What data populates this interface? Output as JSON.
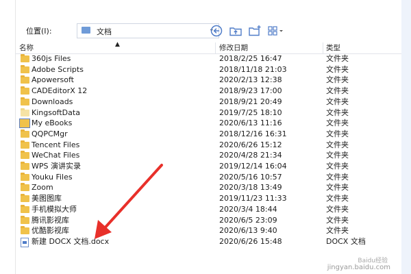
{
  "location": {
    "label": "位置(I):",
    "value": "文档"
  },
  "columns": {
    "name": "名称",
    "date": "修改日期",
    "type": "类型"
  },
  "files": [
    {
      "name": "360js Files",
      "date": "2018/2/25 16:47",
      "type": "文件夹",
      "icon": "folder-icon"
    },
    {
      "name": "Adobe Scripts",
      "date": "2018/11/18 21:03",
      "type": "文件夹",
      "icon": "folder-icon"
    },
    {
      "name": "Apowersoft",
      "date": "2020/2/13 12:38",
      "type": "文件夹",
      "icon": "folder-icon"
    },
    {
      "name": "CADEditorX 12",
      "date": "2018/9/23 17:00",
      "type": "文件夹",
      "icon": "folder-icon"
    },
    {
      "name": "Downloads",
      "date": "2018/9/21 20:49",
      "type": "文件夹",
      "icon": "folder-icon"
    },
    {
      "name": "KingsoftData",
      "date": "2019/7/25 18:10",
      "type": "文件夹",
      "icon": "folder-icon"
    },
    {
      "name": "My eBooks",
      "date": "2020/6/13 11:16",
      "type": "文件夹",
      "icon": "ebook-folder-icon"
    },
    {
      "name": "QQPCMgr",
      "date": "2018/12/16 16:31",
      "type": "文件夹",
      "icon": "folder-icon"
    },
    {
      "name": "Tencent Files",
      "date": "2020/6/26 15:12",
      "type": "文件夹",
      "icon": "folder-icon"
    },
    {
      "name": "WeChat Files",
      "date": "2020/4/28 21:34",
      "type": "文件夹",
      "icon": "folder-icon"
    },
    {
      "name": "WPS 演讲实录",
      "date": "2019/12/14 16:04",
      "type": "文件夹",
      "icon": "folder-icon"
    },
    {
      "name": "Youku Files",
      "date": "2020/5/16 10:57",
      "type": "文件夹",
      "icon": "folder-icon"
    },
    {
      "name": "Zoom",
      "date": "2020/3/18 13:49",
      "type": "文件夹",
      "icon": "folder-icon"
    },
    {
      "name": "美图图库",
      "date": "2019/11/23 11:33",
      "type": "文件夹",
      "icon": "folder-icon"
    },
    {
      "name": "手机模拟大师",
      "date": "2020/3/4 18:44",
      "type": "文件夹",
      "icon": "folder-icon"
    },
    {
      "name": "腾讯影视库",
      "date": "2020/6/5 23:09",
      "type": "文件夹",
      "icon": "folder-icon"
    },
    {
      "name": "优酷影视库",
      "date": "2020/6/13 9:40",
      "type": "文件夹",
      "icon": "folder-icon"
    },
    {
      "name": "新建 DOCX 文档.docx",
      "date": "2020/6/26 15:48",
      "type": "DOCX 文档",
      "icon": "docx-file-icon"
    }
  ],
  "watermark": {
    "line1": "Baidu经验",
    "line2": "jingyan.baidu.com"
  },
  "colors": {
    "arrow": "#e8302a",
    "folder": "#f0c24b",
    "accent": "#4f7cc8"
  }
}
